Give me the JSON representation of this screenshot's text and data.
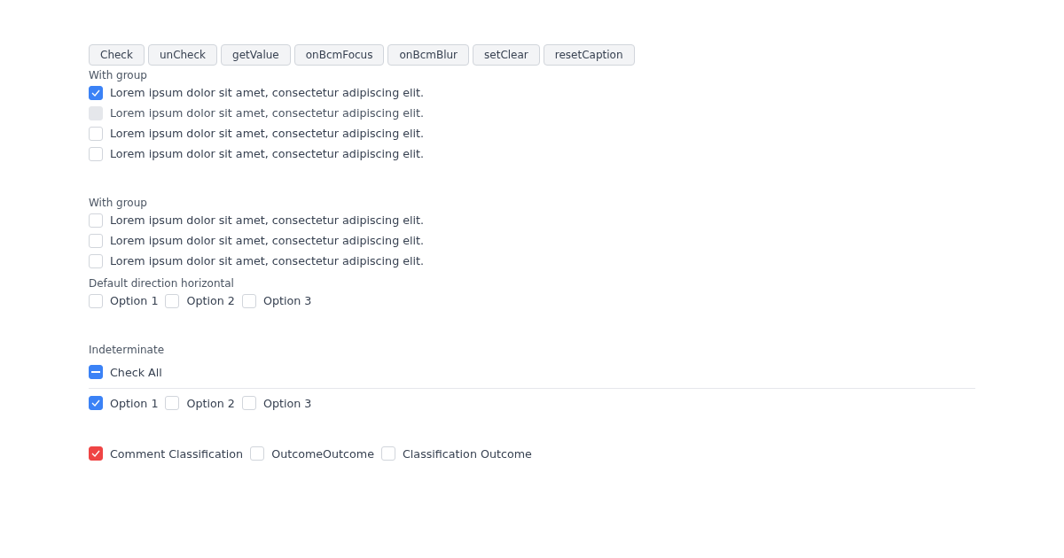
{
  "buttons": [
    "Check",
    "unCheck",
    "getValue",
    "onBcmFocus",
    "onBcmBlur",
    "setClear",
    "resetCaption"
  ],
  "sections": [
    {
      "kind": "vertical",
      "label": "With group",
      "options": [
        {
          "label": "Lorem ipsum dolor sit amet, consectetur adipiscing elit.",
          "checked": true,
          "disabled": false
        },
        {
          "label": "Lorem ipsum dolor sit amet, consectetur adipiscing elit.",
          "checked": false,
          "disabled": true
        },
        {
          "label": "Lorem ipsum dolor sit amet, consectetur adipiscing elit.",
          "checked": false,
          "disabled": false
        },
        {
          "label": "Lorem ipsum dolor sit amet, consectetur adipiscing elit.",
          "checked": false,
          "disabled": false
        }
      ]
    },
    {
      "kind": "vertical",
      "label": "With group",
      "options": [
        {
          "label": "Lorem ipsum dolor sit amet, consectetur adipiscing elit.",
          "checked": false,
          "disabled": false
        },
        {
          "label": "Lorem ipsum dolor sit amet, consectetur adipiscing elit.",
          "checked": false,
          "disabled": false
        },
        {
          "label": "Lorem ipsum dolor sit amet, consectetur adipiscing elit.",
          "checked": false,
          "disabled": false
        }
      ]
    },
    {
      "kind": "horizontal",
      "label": "Default direction horizontal",
      "options": [
        {
          "label": "Option 1",
          "checked": false,
          "disabled": false
        },
        {
          "label": "Option 2",
          "checked": false,
          "disabled": false
        },
        {
          "label": "Option 3",
          "checked": false,
          "disabled": false
        }
      ]
    },
    {
      "kind": "indeterminate",
      "label": "Indeterminate",
      "check_all": {
        "label": "Check All",
        "indeterminate": true
      },
      "options": [
        {
          "label": "Option 1",
          "checked": true,
          "disabled": false
        },
        {
          "label": "Option 2",
          "checked": false,
          "disabled": false
        },
        {
          "label": "Option 3",
          "checked": false,
          "disabled": false
        }
      ]
    },
    {
      "kind": "horizontal",
      "options": [
        {
          "label": "Comment Classification",
          "checked": true,
          "disabled": false,
          "color": "#ef4444"
        },
        {
          "label": "OutcomeOutcome",
          "checked": false,
          "disabled": false
        },
        {
          "label": "Classification Outcome",
          "checked": false,
          "disabled": false
        }
      ]
    }
  ]
}
